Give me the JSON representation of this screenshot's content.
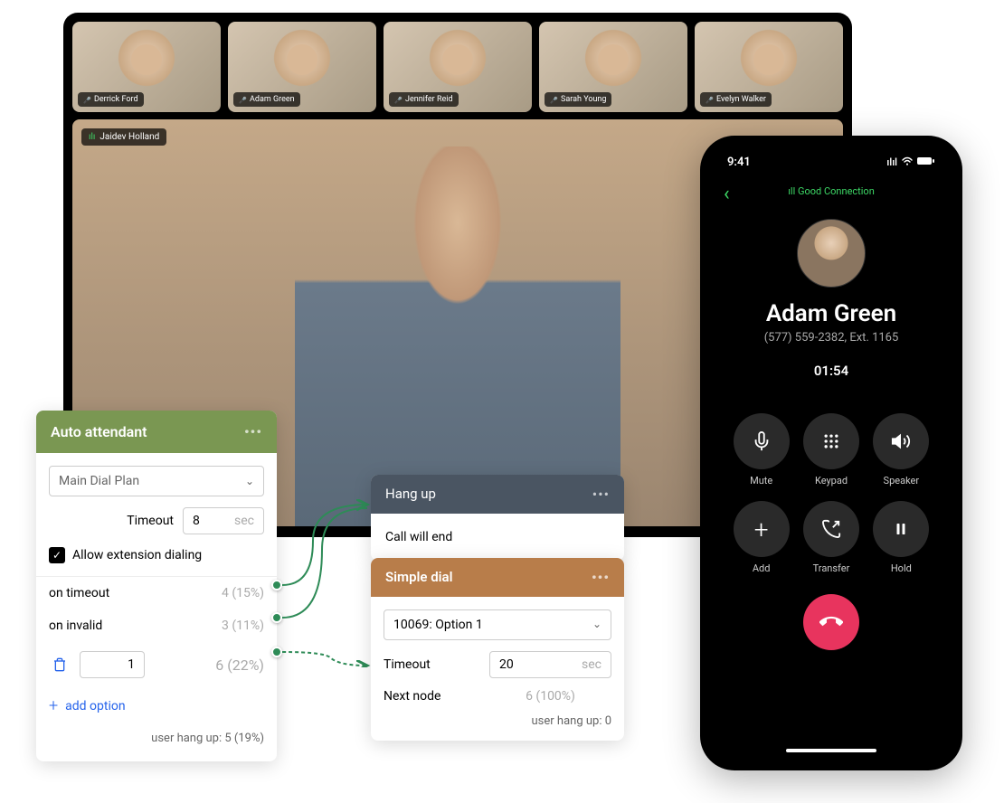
{
  "meeting": {
    "participants": [
      {
        "name": "Derrick Ford"
      },
      {
        "name": "Adam Green"
      },
      {
        "name": "Jennifer Reid"
      },
      {
        "name": "Sarah Young"
      },
      {
        "name": "Evelyn Walker"
      }
    ],
    "main_speaker": "Jaidev Holland"
  },
  "auto_attendant": {
    "title": "Auto attendant",
    "plan": "Main Dial Plan",
    "timeout_label": "Timeout",
    "timeout_value": "8",
    "timeout_unit": "sec",
    "allow_ext_label": "Allow extension dialing",
    "options": [
      {
        "label": "on timeout",
        "stat": "4 (15%)"
      },
      {
        "label": "on invalid",
        "stat": "3 (11%)"
      }
    ],
    "num_option": {
      "value": "1",
      "stat": "6 (22%)"
    },
    "add_label": "add option",
    "footer": "user hang up: 5 (19%)"
  },
  "hangup": {
    "title": "Hang up",
    "body": "Call will end"
  },
  "simple_dial": {
    "title": "Simple dial",
    "option": "10069: Option 1",
    "timeout_label": "Timeout",
    "timeout_value": "20",
    "timeout_unit": "sec",
    "next_label": "Next node",
    "next_stat": "6 (100%)",
    "footer": "user hang up: 0"
  },
  "phone": {
    "time": "9:41",
    "connection": "Good Connection",
    "caller_name": "Adam Green",
    "caller_number": "(577) 559-2382, Ext. 1165",
    "timer": "01:54",
    "buttons": [
      {
        "label": "Mute",
        "icon": "mic"
      },
      {
        "label": "Keypad",
        "icon": "keypad"
      },
      {
        "label": "Speaker",
        "icon": "speaker"
      },
      {
        "label": "Add",
        "icon": "plus"
      },
      {
        "label": "Transfer",
        "icon": "transfer"
      },
      {
        "label": "Hold",
        "icon": "pause"
      }
    ]
  }
}
